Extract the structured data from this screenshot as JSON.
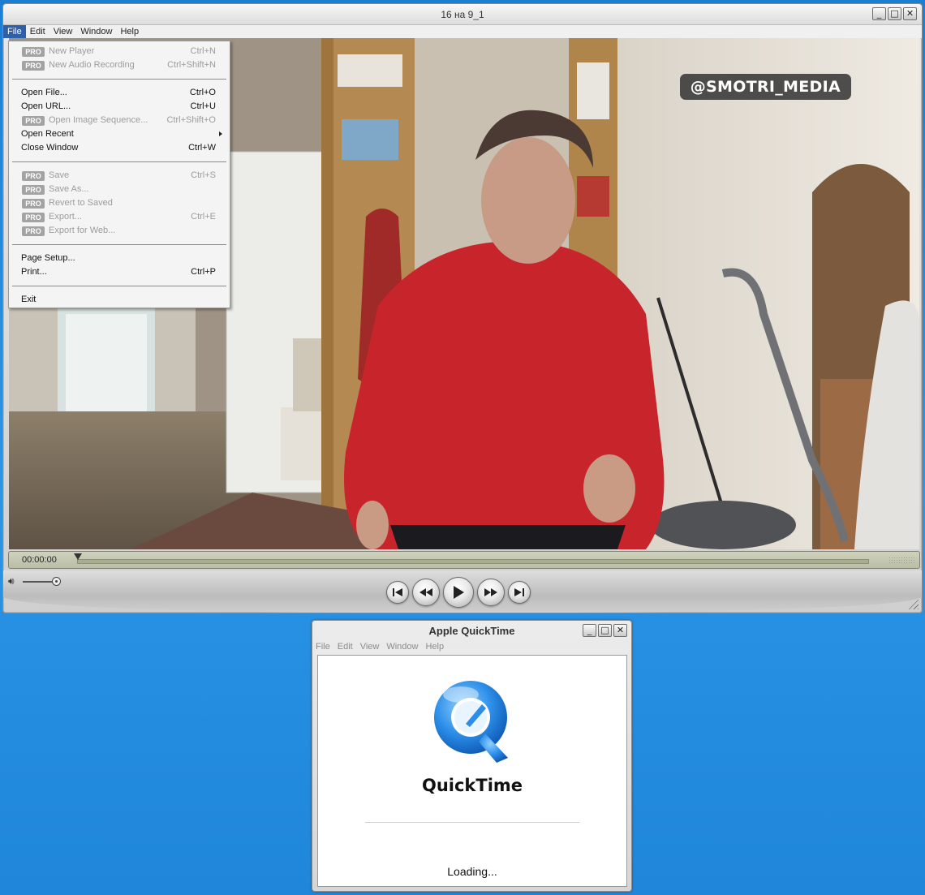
{
  "player": {
    "title": "16 на 9_1",
    "window_buttons": [
      "_",
      "□",
      "✕"
    ],
    "menu": [
      "File",
      "Edit",
      "View",
      "Window",
      "Help"
    ],
    "active_menu": "File",
    "watermark": "@SMOTRI_MEDIA",
    "time": "00:00:00",
    "progress": 0,
    "volume": 0.9
  },
  "file_menu": {
    "pro_badge": "PRO",
    "items": [
      {
        "label": "New Player",
        "shortcut": "Ctrl+N",
        "pro": true,
        "enabled": false
      },
      {
        "label": "New Audio Recording",
        "shortcut": "Ctrl+Shift+N",
        "pro": true,
        "enabled": false
      },
      {
        "label": "Open File...",
        "shortcut": "Ctrl+O",
        "pro": false,
        "enabled": true
      },
      {
        "label": "Open URL...",
        "shortcut": "Ctrl+U",
        "pro": false,
        "enabled": true
      },
      {
        "label": "Open Image Sequence...",
        "shortcut": "Ctrl+Shift+O",
        "pro": true,
        "enabled": false
      },
      {
        "label": "Open Recent",
        "shortcut": "",
        "pro": false,
        "enabled": true,
        "submenu": true
      },
      {
        "label": "Close Window",
        "shortcut": "Ctrl+W",
        "pro": false,
        "enabled": true
      },
      {
        "label": "Save",
        "shortcut": "Ctrl+S",
        "pro": true,
        "enabled": false
      },
      {
        "label": "Save As...",
        "shortcut": "",
        "pro": true,
        "enabled": false
      },
      {
        "label": "Revert to Saved",
        "shortcut": "",
        "pro": true,
        "enabled": false
      },
      {
        "label": "Export...",
        "shortcut": "Ctrl+E",
        "pro": true,
        "enabled": false
      },
      {
        "label": "Export for Web...",
        "shortcut": "",
        "pro": true,
        "enabled": false
      },
      {
        "label": "Page Setup...",
        "shortcut": "",
        "pro": false,
        "enabled": true
      },
      {
        "label": "Print...",
        "shortcut": "Ctrl+P",
        "pro": false,
        "enabled": true
      },
      {
        "label": "Exit",
        "shortcut": "",
        "pro": false,
        "enabled": true
      }
    ]
  },
  "transport": [
    "go-to-start",
    "rewind",
    "play",
    "fast-forward",
    "go-to-end"
  ],
  "loader": {
    "title": "Apple QuickTime",
    "window_buttons": [
      "_",
      "□",
      "✕"
    ],
    "menu": [
      "File",
      "Edit",
      "View",
      "Window",
      "Help"
    ],
    "product_name": "QuickTime",
    "status": "Loading..."
  },
  "colors": {
    "desktop": "#1f86d9",
    "menu_highlight": "#2f5fa8",
    "sweater_red": "#c8242c",
    "qt_blue": "#1b78d6"
  }
}
